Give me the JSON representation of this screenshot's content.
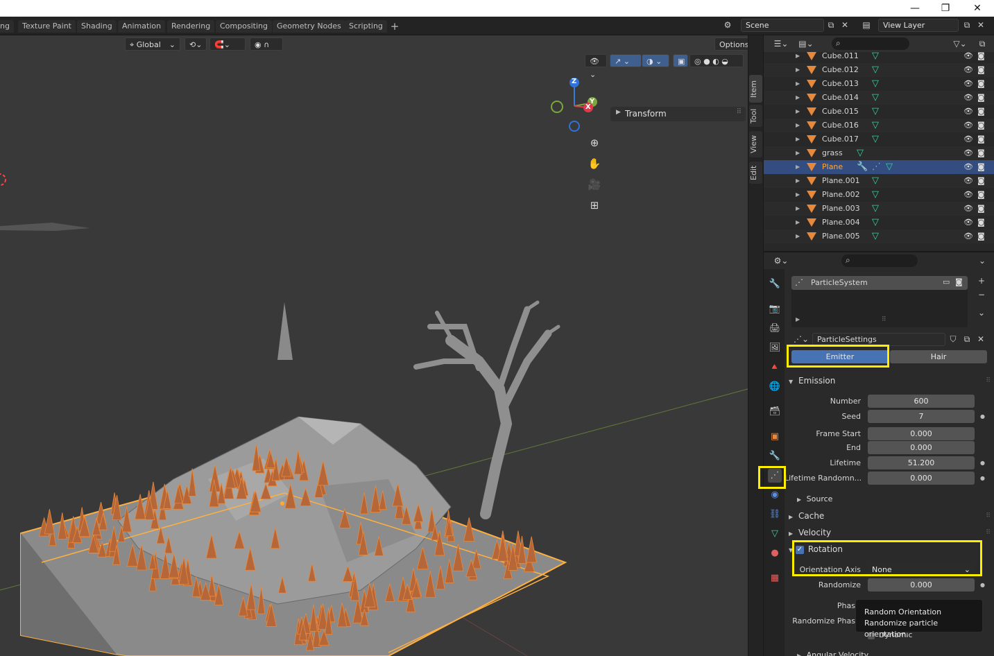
{
  "window": {
    "minimize": "—",
    "maximize": "❐",
    "close": "✕"
  },
  "workspaces": [
    "ng",
    "Texture Paint",
    "Shading",
    "Animation",
    "Rendering",
    "Compositing",
    "Geometry Nodes",
    "Scripting"
  ],
  "add_workspace": "+",
  "scene": {
    "label": "Scene",
    "view_layer": "View Layer"
  },
  "viewport": {
    "transform_orientation": "Global",
    "options_label": "Options",
    "transform_panel": "Transform",
    "sidebar_tabs": [
      "Item",
      "Tool",
      "View",
      "Edit"
    ],
    "gizmo": {
      "z": "Z",
      "y": "Y",
      "x": "X"
    }
  },
  "outliner": {
    "rows": [
      {
        "name": "Cube.011",
        "selected": false
      },
      {
        "name": "Cube.012",
        "selected": false
      },
      {
        "name": "Cube.013",
        "selected": false
      },
      {
        "name": "Cube.014",
        "selected": false
      },
      {
        "name": "Cube.015",
        "selected": false
      },
      {
        "name": "Cube.016",
        "selected": false
      },
      {
        "name": "Cube.017",
        "selected": false
      },
      {
        "name": "grass",
        "selected": false
      },
      {
        "name": "Plane",
        "selected": true
      },
      {
        "name": "Plane.001",
        "selected": false
      },
      {
        "name": "Plane.002",
        "selected": false
      },
      {
        "name": "Plane.003",
        "selected": false
      },
      {
        "name": "Plane.004",
        "selected": false
      },
      {
        "name": "Plane.005",
        "selected": false
      }
    ]
  },
  "properties": {
    "particle_system": "ParticleSystem",
    "particle_settings": "ParticleSettings",
    "type_emitter": "Emitter",
    "type_hair": "Hair",
    "emission": {
      "title": "Emission",
      "number_label": "Number",
      "number": "600",
      "seed_label": "Seed",
      "seed": "7",
      "frame_start_label": "Frame Start",
      "frame_start": "0.000",
      "end_label": "End",
      "end": "0.000",
      "lifetime_label": "Lifetime",
      "lifetime": "51.200",
      "lifetime_random_label": "Lifetime Randomn...",
      "lifetime_random": "0.000",
      "source": "Source"
    },
    "cache": "Cache",
    "velocity": "Velocity",
    "rotation": {
      "title": "Rotation",
      "orientation_axis_label": "Orientation Axis",
      "orientation_axis": "None",
      "randomize_label": "Randomize",
      "randomize": "0.000",
      "phase_label": "Phas",
      "randomize_phase_label": "Randomize Phas",
      "dynamic_label": "Dynamic"
    },
    "angular_velocity": "Angular Velocity"
  },
  "tooltip": {
    "title": "Random Orientation",
    "description": "Randomize particle orientation."
  },
  "colors": {
    "accent_blue": "#4772b3",
    "selection_orange": "#e8883a",
    "highlight_yellow": "#ffee00",
    "mesh_green": "#3fcfa0"
  }
}
